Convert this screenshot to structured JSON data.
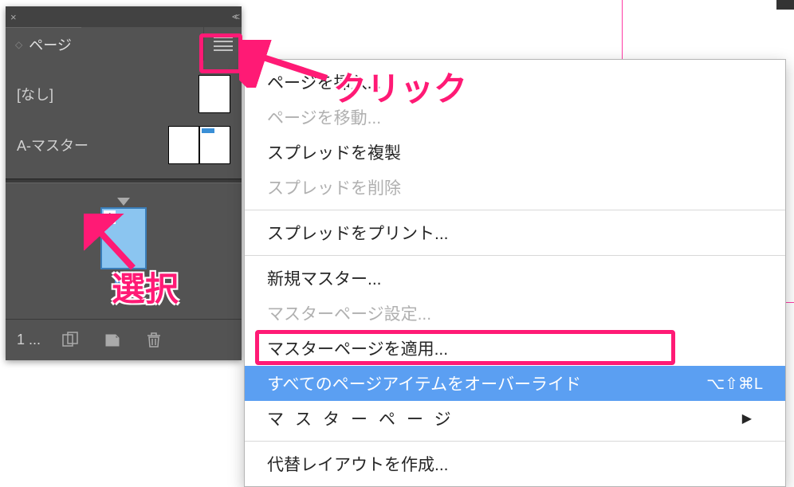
{
  "panel": {
    "tab_label": "ページ",
    "master_none_label": "[なし]",
    "master_a_label": "A-マスター",
    "page_thumb_corner": "A",
    "page_number": "1",
    "footer_count": "1 ..."
  },
  "menu": {
    "items": [
      {
        "label": "ページを挿入...",
        "enabled": true
      },
      {
        "label": "ページを移動...",
        "enabled": false
      },
      {
        "label": "スプレッドを複製",
        "enabled": true
      },
      {
        "label": "スプレッドを削除",
        "enabled": false
      }
    ],
    "items2": [
      {
        "label": "スプレッドをプリント...",
        "enabled": true
      }
    ],
    "items3": [
      {
        "label": "新規マスター...",
        "enabled": true
      },
      {
        "label": "マスターページ設定...",
        "enabled": false
      },
      {
        "label": "マスターページを適用...",
        "enabled": true
      },
      {
        "label": "すべてのページアイテムをオーバーライド",
        "enabled": true,
        "selected": true,
        "shortcut": "⌥⇧⌘L"
      },
      {
        "label": "マスターページ",
        "enabled": true,
        "submenu": true,
        "spaced": true
      }
    ],
    "items4": [
      {
        "label": "代替レイアウトを作成...",
        "enabled": true
      }
    ]
  },
  "annotations": {
    "click_label": "クリック",
    "select_label": "選択"
  }
}
